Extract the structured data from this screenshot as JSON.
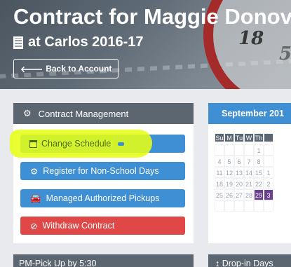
{
  "hero": {
    "title": "Contract for Maggie Donova",
    "subtitle": "at Carlos 2016-17",
    "back_label": "Back to Account",
    "clock_numerals": [
      "18",
      "5"
    ]
  },
  "contract_management": {
    "heading": "Contract Management",
    "buttons": {
      "change_schedule": "Change Schedule",
      "register_non_school": "Register for Non-School Days",
      "authorized_pickups": "Managed Authorized Pickups",
      "withdraw": "Withdraw Contract"
    }
  },
  "calendar": {
    "heading": "September 201",
    "days_of_week": [
      "Su",
      "M",
      "Tu",
      "W",
      "Th",
      ""
    ],
    "weeks": [
      [
        "",
        "",
        "",
        "",
        "1",
        ""
      ],
      [
        "4",
        "5",
        "6",
        "7",
        "8",
        ""
      ],
      [
        "11",
        "12",
        "13",
        "14",
        "15",
        "1"
      ],
      [
        "18",
        "19",
        "20",
        "21",
        "22",
        "2"
      ],
      [
        "25",
        "26",
        "27",
        "28",
        "29",
        "3"
      ],
      [
        "",
        "",
        "",
        "",
        "",
        ""
      ]
    ]
  },
  "bottom": {
    "left_heading": "PM-Pick Up by 5:30",
    "right_heading": "Drop-in Days"
  },
  "colors": {
    "primary_blue": "#3f8fd4",
    "danger_red": "#e04848",
    "panel_header": "#5c6670",
    "highlight": "#e6ff14",
    "selected_day": "#6a3f8f"
  }
}
